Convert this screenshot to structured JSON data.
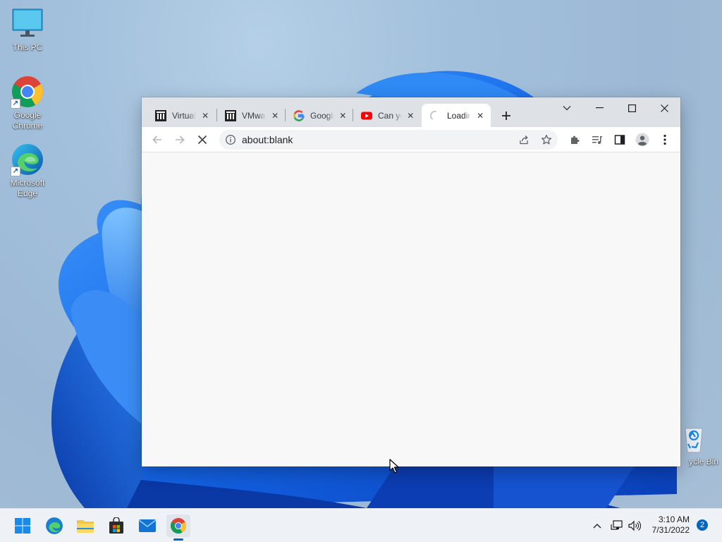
{
  "desktop": {
    "icons": [
      {
        "label": "This PC",
        "icon": "monitor-icon"
      },
      {
        "label": "Google Chrome",
        "icon": "chrome-icon"
      },
      {
        "label": "Microsoft Edge",
        "icon": "edge-icon"
      },
      {
        "label": "ycle Bin",
        "icon": "recycle-bin-icon"
      }
    ]
  },
  "browser": {
    "tabs": [
      {
        "title": "Virtual",
        "favicon": "archive-icon",
        "active": false
      },
      {
        "title": "VMware",
        "favicon": "archive-icon",
        "active": false
      },
      {
        "title": "Google",
        "favicon": "google-icon",
        "active": false
      },
      {
        "title": "Can you",
        "favicon": "youtube-icon",
        "active": false
      },
      {
        "title": "Loading",
        "favicon": "loading-spinner-icon",
        "active": true
      }
    ],
    "url": "about:blank",
    "accent": "#1a73e8"
  },
  "taskbar": {
    "apps": [
      "start-icon",
      "edge-icon",
      "file-explorer-icon",
      "store-icon",
      "mail-icon",
      "chrome-icon"
    ],
    "time": "3:10 AM",
    "date": "7/31/2022",
    "notification_count": "2"
  }
}
